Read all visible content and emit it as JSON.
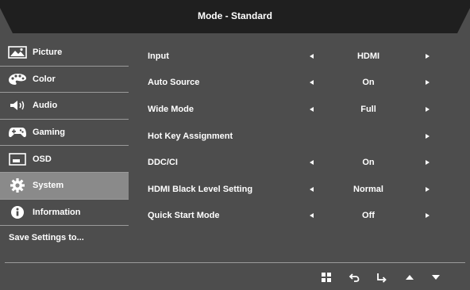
{
  "header": {
    "title": "Mode - Standard"
  },
  "sidebar": {
    "items": [
      {
        "label": "Picture",
        "icon": "picture-icon"
      },
      {
        "label": "Color",
        "icon": "palette-icon"
      },
      {
        "label": "Audio",
        "icon": "speaker-icon"
      },
      {
        "label": "Gaming",
        "icon": "gamepad-icon"
      },
      {
        "label": "OSD",
        "icon": "osd-icon"
      },
      {
        "label": "System",
        "icon": "gear-icon",
        "selected": true
      },
      {
        "label": "Information",
        "icon": "info-icon"
      }
    ],
    "save_label": "Save Settings to..."
  },
  "settings": {
    "rows": [
      {
        "label": "Input",
        "value": "HDMI"
      },
      {
        "label": "Auto Source",
        "value": "On"
      },
      {
        "label": "Wide Mode",
        "value": "Full"
      },
      {
        "label": "Hot Key Assignment",
        "value": ""
      },
      {
        "label": "DDC/CI",
        "value": "On"
      },
      {
        "label": "HDMI Black Level Setting",
        "value": "Normal"
      },
      {
        "label": "Quick Start Mode",
        "value": "Off"
      }
    ]
  },
  "footer": {
    "icons": [
      "menu-grid-icon",
      "back-icon",
      "enter-icon",
      "up-arrow-icon",
      "down-arrow-icon"
    ]
  },
  "colors": {
    "panel": "#4d4d4d",
    "header": "#1f1f1f",
    "selected": "#8a8a8a",
    "text": "#ffffff"
  }
}
